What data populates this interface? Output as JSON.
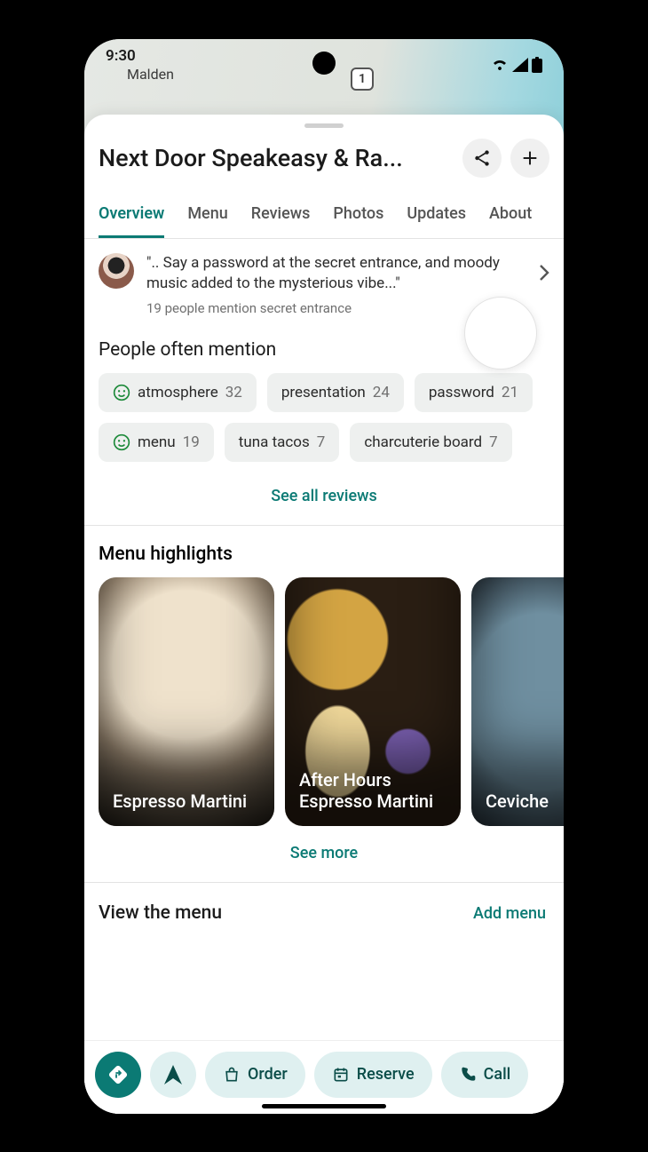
{
  "status": {
    "time": "9:30",
    "location": "Malden",
    "route": "1"
  },
  "header": {
    "title": "Next Door Speakeasy & Ra..."
  },
  "tabs": [
    "Overview",
    "Menu",
    "Reviews",
    "Photos",
    "Updates",
    "About"
  ],
  "active_tab": 0,
  "snippet": {
    "quote": "\".. Say a password at the secret entrance, and moody music added to the mysterious vibe...\"",
    "subtext": "19 people mention secret entrance"
  },
  "mentions": {
    "title": "People often mention",
    "chips": [
      {
        "icon": "smile",
        "label": "atmosphere",
        "count": 32
      },
      {
        "label": "presentation",
        "count": 24
      },
      {
        "label": "password",
        "count": 21
      },
      {
        "icon": "smile",
        "label": "menu",
        "count": 19
      },
      {
        "label": "tuna tacos",
        "count": 7
      },
      {
        "label": "charcuterie board",
        "count": 7
      }
    ],
    "see_all": "See all reviews"
  },
  "menu_highlights": {
    "title": "Menu highlights",
    "items": [
      "Espresso Martini",
      "After Hours Espresso Martini",
      "Ceviche"
    ],
    "see_more": "See more"
  },
  "view_menu": {
    "title": "View the menu",
    "add": "Add menu"
  },
  "actions": {
    "order": "Order",
    "reserve": "Reserve",
    "call": "Call"
  }
}
